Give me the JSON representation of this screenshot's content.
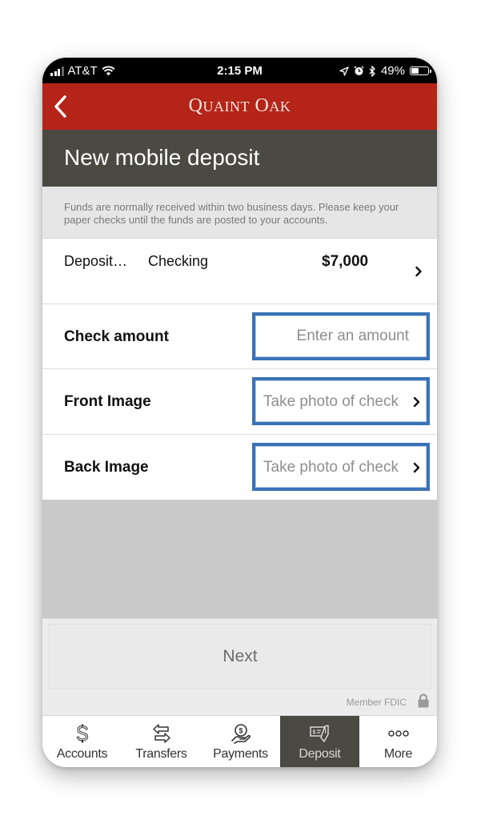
{
  "status_bar": {
    "carrier": "AT&T",
    "time": "2:15 PM",
    "battery_percent_label": "49%",
    "battery_level": 0.49,
    "icons": [
      "signal-icon",
      "wifi-icon",
      "location-icon",
      "alarm-icon",
      "bluetooth-icon",
      "battery-icon"
    ]
  },
  "header": {
    "brand_q": "Q",
    "brand_uaint": "UAINT",
    "brand_space": " ",
    "brand_o": "O",
    "brand_ak": "AK",
    "brand_full": "Quaint Oak",
    "back_icon": "chevron-left-icon"
  },
  "page": {
    "title": "New mobile deposit",
    "info_text": "Funds are normally received within two business days. Please keep your paper checks until the funds are posted to your accounts."
  },
  "deposit_row": {
    "label": "Deposit…",
    "account": "Checking",
    "amount": "$7,000"
  },
  "form": {
    "check_amount": {
      "label": "Check amount",
      "value": "",
      "placeholder": "Enter an amount"
    },
    "front_image": {
      "label": "Front Image",
      "placeholder": "Take photo of check"
    },
    "back_image": {
      "label": "Back Image",
      "placeholder": "Take photo of check"
    }
  },
  "actions": {
    "next_label": "Next",
    "fdic_label": "Member FDIC"
  },
  "tab_bar": {
    "tabs": [
      {
        "label": "Accounts",
        "icon": "dollar-icon",
        "active": false
      },
      {
        "label": "Transfers",
        "icon": "transfer-arrows-icon",
        "active": false
      },
      {
        "label": "Payments",
        "icon": "hand-coin-icon",
        "active": false
      },
      {
        "label": "Deposit",
        "icon": "check-deposit-icon",
        "active": true
      },
      {
        "label": "More",
        "icon": "more-dots-icon",
        "active": false
      }
    ]
  },
  "colors": {
    "brand_red": "#b52418",
    "title_bar": "#4a4942",
    "highlight_blue": "#3a72b8",
    "active_tab": "#4a4942"
  }
}
